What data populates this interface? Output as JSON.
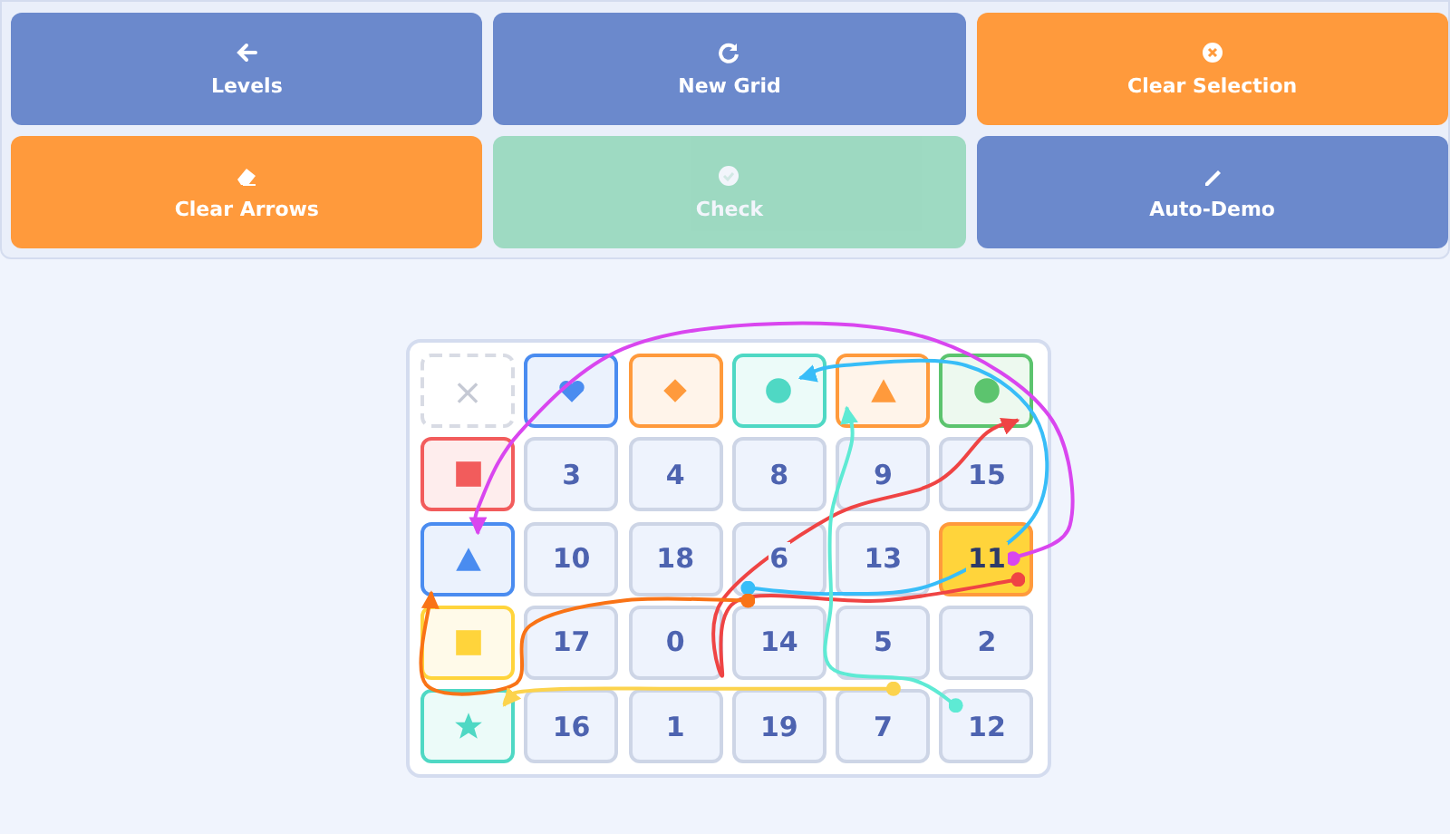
{
  "buttons": [
    {
      "label": "Levels",
      "disabled": false
    },
    {
      "label": "New Grid",
      "disabled": false
    },
    {
      "label": "Clear Selection",
      "disabled": false
    },
    {
      "label": "Clear Arrows",
      "disabled": false
    },
    {
      "label": "Check",
      "disabled": true
    },
    {
      "label": "Auto-Demo",
      "disabled": false
    }
  ],
  "grid": {
    "rows": [
      [
        {
          "kind": "corner",
          "text": "×"
        },
        {
          "kind": "heart",
          "color": "#4a8cf0"
        },
        {
          "kind": "diamond",
          "color": "#ff9a3c"
        },
        {
          "kind": "circle",
          "color": "#4fd8c4"
        },
        {
          "kind": "triangle",
          "color": "#ff9a3c"
        },
        {
          "kind": "circle",
          "color": "#5cc46e"
        }
      ],
      [
        {
          "kind": "square",
          "color": "#f25c5c"
        },
        {
          "kind": "number",
          "text": "3",
          "selected": false
        },
        {
          "kind": "number",
          "text": "4",
          "selected": false
        },
        {
          "kind": "number",
          "text": "8",
          "selected": false
        },
        {
          "kind": "number",
          "text": "9",
          "selected": false
        },
        {
          "kind": "number",
          "text": "15",
          "selected": false
        }
      ],
      [
        {
          "kind": "triangle",
          "color": "#4a8cf0"
        },
        {
          "kind": "number",
          "text": "10",
          "selected": false
        },
        {
          "kind": "number",
          "text": "18",
          "selected": false
        },
        {
          "kind": "number",
          "text": "6",
          "selected": false
        },
        {
          "kind": "number",
          "text": "13",
          "selected": false
        },
        {
          "kind": "number",
          "text": "11",
          "selected": true
        }
      ],
      [
        {
          "kind": "square",
          "color": "#ffd43b"
        },
        {
          "kind": "number",
          "text": "17",
          "selected": false
        },
        {
          "kind": "number",
          "text": "0",
          "selected": false
        },
        {
          "kind": "number",
          "text": "14",
          "selected": false
        },
        {
          "kind": "number",
          "text": "5",
          "selected": false
        },
        {
          "kind": "number",
          "text": "2",
          "selected": false
        }
      ],
      [
        {
          "kind": "star",
          "color": "#4fd8c4"
        },
        {
          "kind": "number",
          "text": "16",
          "selected": false
        },
        {
          "kind": "number",
          "text": "1",
          "selected": false
        },
        {
          "kind": "number",
          "text": "19",
          "selected": false
        },
        {
          "kind": "number",
          "text": "7",
          "selected": false
        },
        {
          "kind": "number",
          "text": "12",
          "selected": false
        }
      ]
    ]
  }
}
